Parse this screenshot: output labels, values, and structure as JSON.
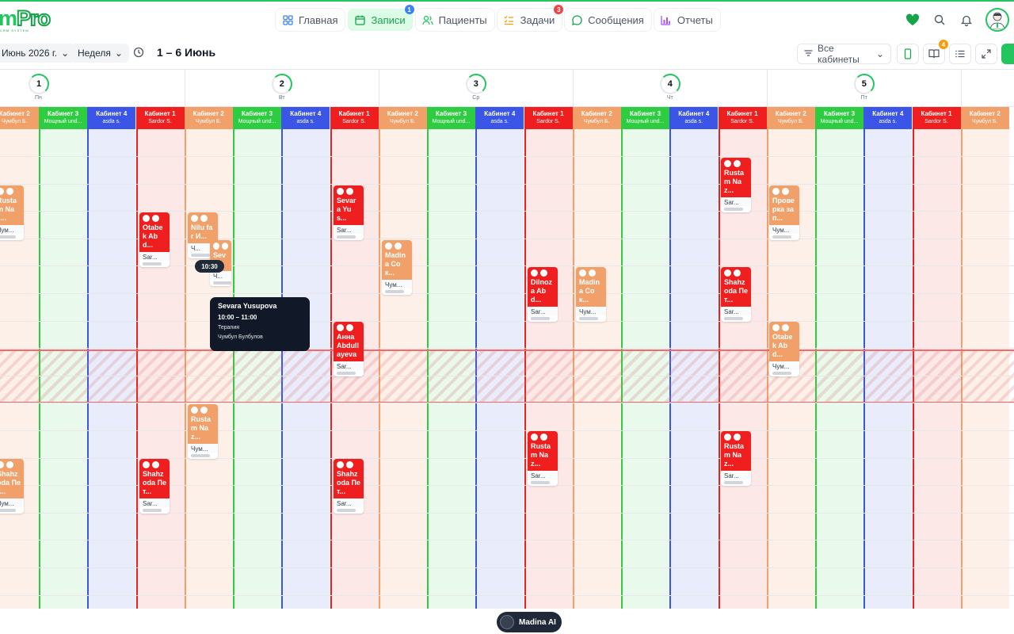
{
  "brand": {
    "logo_text_a": "m",
    "logo_text_b": "Pro",
    "logo_sub": "CRM SYSTEM"
  },
  "nav": [
    {
      "label": "Главная",
      "icon": "grid-icon",
      "active": false
    },
    {
      "label": "Записи",
      "icon": "calendar-icon",
      "active": true,
      "badge": "1"
    },
    {
      "label": "Пациенты",
      "icon": "users-icon",
      "active": false
    },
    {
      "label": "Задачи",
      "icon": "checklist-icon",
      "active": false,
      "badge": "3"
    },
    {
      "label": "Сообщения",
      "icon": "chat-icon",
      "active": false
    },
    {
      "label": "Отчеты",
      "icon": "bar-chart-icon",
      "active": false
    }
  ],
  "toolbar": {
    "date_select": "Июнь 2026 г.",
    "view_select": "Неделя",
    "range_title": "1 – 6 Июнь",
    "cabinet_filter": "Все кабинеты",
    "notif_badge": "4"
  },
  "days": [
    {
      "num": "1",
      "label": "Пн"
    },
    {
      "num": "2",
      "label": "Вт"
    },
    {
      "num": "3",
      "label": "Ср"
    },
    {
      "num": "4",
      "label": "Чт"
    },
    {
      "num": "5",
      "label": "Пт"
    },
    {
      "num": "6",
      "label": "Сб"
    }
  ],
  "cabinets": [
    {
      "name": "Кабинет 1",
      "doctor": "Sardor S.",
      "color": "#ef1f1f",
      "bg": "#fde8e8"
    },
    {
      "name": "Кабинет 2",
      "doctor": "Чумбул Б.",
      "color": "#f0a068",
      "bg": "#fdf0e8"
    },
    {
      "name": "Кабинет 3",
      "doctor": "Мощный und...",
      "color": "#2ecc40",
      "bg": "#e9f9ec"
    },
    {
      "name": "Кабинет 4",
      "doctor": "asda s.",
      "color": "#3b55e6",
      "bg": "#e9ecfb"
    }
  ],
  "appointments": [
    {
      "name": "Rusta m Naz...",
      "doctor": "Чум...",
      "kind": "orange"
    },
    {
      "name": "Shahz oda Пет...",
      "doctor": "Чум...",
      "kind": "orange"
    },
    {
      "name": "Otabe k Abd...",
      "doctor": "Sar...",
      "kind": "red"
    },
    {
      "name": "Nilu far И...",
      "doctor": "Ч...",
      "kind": "orange"
    },
    {
      "name": "Sev a...",
      "doctor": "Ч...",
      "kind": "orange"
    },
    {
      "name": "Rusta m Naz...",
      "doctor": "Чум...",
      "kind": "orange"
    },
    {
      "name": "Shahz oda Пет...",
      "doctor": "Sar...",
      "kind": "red"
    },
    {
      "name": "Sevar a Yus...",
      "doctor": "Sar...",
      "kind": "red"
    },
    {
      "name": "Madin a Сок...",
      "doctor": "Чум...",
      "kind": "orange"
    },
    {
      "name": "Анна Abdull ayeva",
      "doctor": "Sar...",
      "kind": "red"
    },
    {
      "name": "Shahz oda Пет...",
      "doctor": "Sar...",
      "kind": "red"
    },
    {
      "name": "Dilnoz a Abd...",
      "doctor": "Sar...",
      "kind": "red"
    },
    {
      "name": "Madin a Сок...",
      "doctor": "Чум...",
      "kind": "orange"
    },
    {
      "name": "Rusta m Naz...",
      "doctor": "Sar...",
      "kind": "red"
    },
    {
      "name": "Rusta m Naz...",
      "doctor": "Sar...",
      "kind": "red"
    },
    {
      "name": "Прове рка зап...",
      "doctor": "Чум...",
      "kind": "orange"
    },
    {
      "name": "Shahz oda Пет...",
      "doctor": "Sar...",
      "kind": "red"
    },
    {
      "name": "Otabe k Abd...",
      "doctor": "Чум...",
      "kind": "orange"
    },
    {
      "name": "Rusta m Naz...",
      "doctor": "Sar...",
      "kind": "red"
    }
  ],
  "tooltip": {
    "patient": "Sevara Yusupova",
    "time": "10:00 – 11:00",
    "service": "Терапия",
    "doctor": "Чумбул Булбулов"
  },
  "time_pill": "10:30",
  "ai_button": {
    "label": "Madina AI"
  }
}
